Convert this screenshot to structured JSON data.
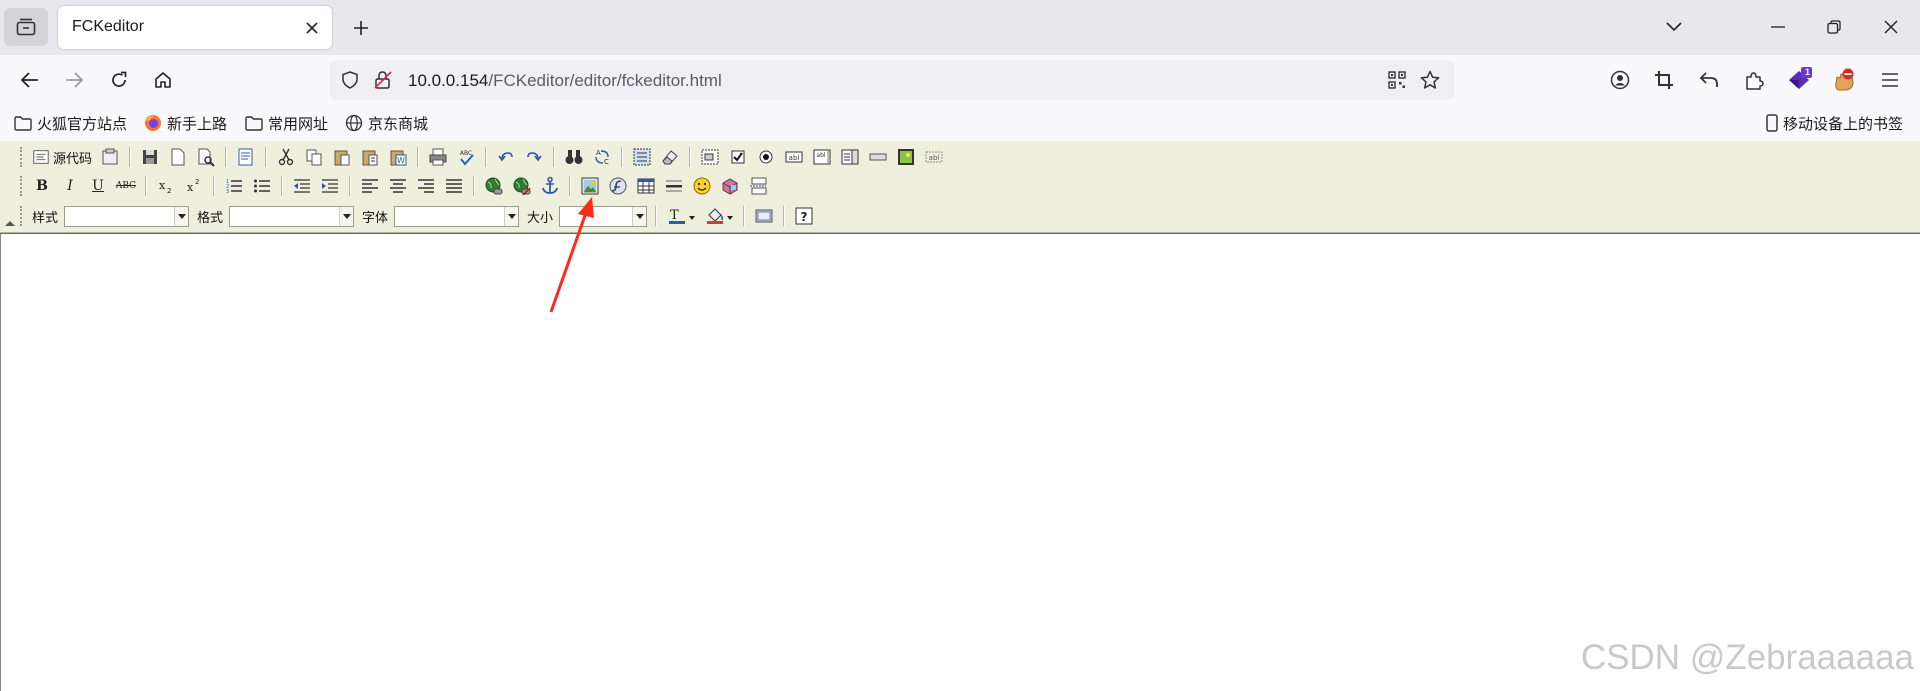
{
  "browser": {
    "tab_title": "FCKeditor",
    "url_host": "10.0.0.154",
    "url_path": "/FCKeditor/editor/fckeditor.html",
    "extension_badge": "1"
  },
  "bookmarks": {
    "items": [
      {
        "label": "火狐官方站点",
        "icon": "folder-icon"
      },
      {
        "label": "新手上路",
        "icon": "firefox-icon"
      },
      {
        "label": "常用网址",
        "icon": "folder-icon"
      },
      {
        "label": "京东商城",
        "icon": "globe-icon"
      }
    ],
    "mobile_label": "移动设备上的书签"
  },
  "editor": {
    "source_label": "源代码",
    "bold_glyph": "B",
    "italic_glyph": "I",
    "underline_glyph": "U",
    "strike_glyph": "ABC",
    "style_label": "样式",
    "format_label": "格式",
    "font_label": "字体",
    "size_label": "大小",
    "style_value": "",
    "format_value": "",
    "font_value": "",
    "size_value": "",
    "annotation_color": "#ff2a1a"
  },
  "watermark": "CSDN @Zebraaaaaa"
}
